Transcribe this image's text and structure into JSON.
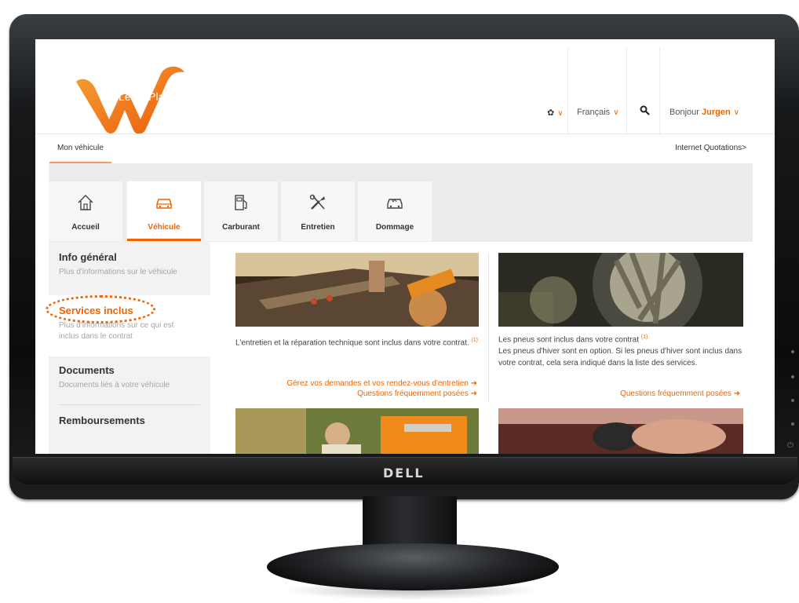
{
  "brand": "DELL",
  "logo_text": "LeasePlan",
  "header": {
    "language": "Français",
    "greeting": "Bonjour",
    "user": "Jurgen"
  },
  "topnav": {
    "tab": "Mon véhicule",
    "right_link": "Internet Quotations>"
  },
  "category_tabs": [
    {
      "label": "Accueil",
      "icon": "home-icon"
    },
    {
      "label": "Véhicule",
      "icon": "car-icon",
      "active": true
    },
    {
      "label": "Carburant",
      "icon": "fuel-pump-icon"
    },
    {
      "label": "Entretien",
      "icon": "tools-icon"
    },
    {
      "label": "Dommage",
      "icon": "damaged-car-icon"
    }
  ],
  "menu": [
    {
      "title": "Info général",
      "desc": "Plus d'informations sur le véhicule"
    },
    {
      "title": "Services inclus",
      "desc": "Plus d'informations sur ce qui est inclus dans le contrat",
      "active": true
    },
    {
      "title": "Documents",
      "desc": "Documents liés à votre véhicule"
    },
    {
      "title": "Remboursements",
      "desc": ""
    }
  ],
  "cards": [
    {
      "text": "L'entretien et la réparation technique sont inclus dans votre contrat.",
      "sup": "(1)",
      "links": [
        "Gérez vos demandes et vos rendez-vous d'entretien",
        "Questions fréquemment posées"
      ]
    },
    {
      "text_line1": "Les pneus sont inclus dans votre contrat",
      "sup": "(1)",
      "text_rest": "Les pneus d'hiver sont en option. Si les pneus d'hiver sont inclus dans votre contrat, cela sera indiqué dans la liste des services.",
      "links": [
        "Questions fréquemment posées"
      ]
    }
  ],
  "colors": {
    "accent": "#f06400",
    "menu_bg": "#f2f2f2",
    "band_bg": "#ececec"
  }
}
